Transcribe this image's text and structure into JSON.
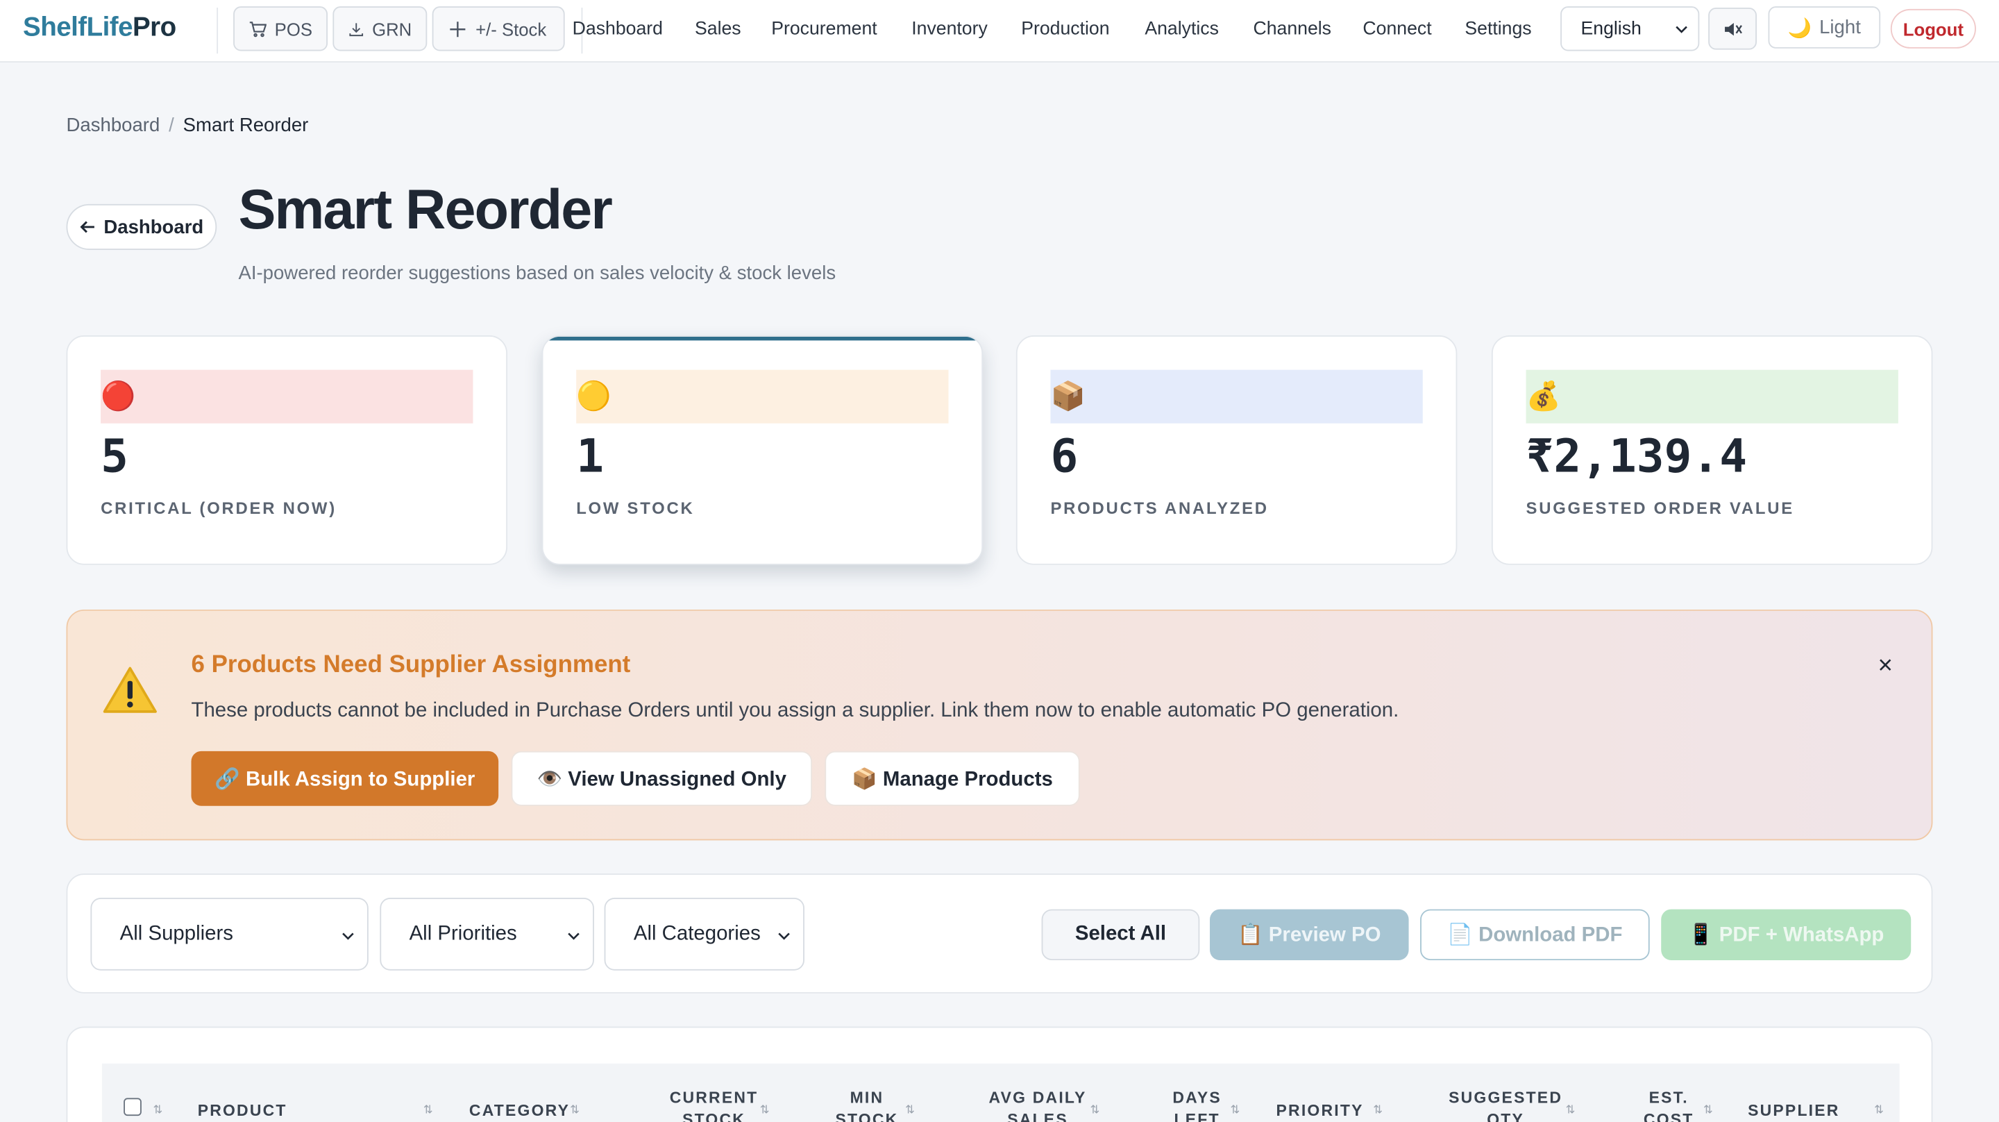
{
  "brand": {
    "part1": "ShelfLife",
    "part2": "Pro"
  },
  "quick_actions": [
    {
      "label": "POS",
      "icon": "cart-icon"
    },
    {
      "label": "GRN",
      "icon": "download-icon"
    },
    {
      "label": "+/- Stock",
      "icon": "plus-icon"
    }
  ],
  "nav": [
    "Dashboard",
    "Sales",
    "Procurement",
    "Inventory",
    "Production",
    "Analytics",
    "Channels",
    "Connect",
    "Settings"
  ],
  "language": "English",
  "theme_label": "Light",
  "logout_label": "Logout",
  "breadcrumb": {
    "root": "Dashboard",
    "sep": "/",
    "current": "Smart Reorder"
  },
  "back_label": "Dashboard",
  "page": {
    "title": "Smart Reorder",
    "subtitle": "AI-powered reorder suggestions based on sales velocity & stock levels"
  },
  "stats": [
    {
      "icon": "🔴",
      "value": "5",
      "label": "Critical (Order Now)",
      "strip": "#fbe2e2"
    },
    {
      "icon": "🟡",
      "value": "1",
      "label": "Low Stock",
      "strip": "#fdf0e1"
    },
    {
      "icon": "📦",
      "value": "6",
      "label": "Products Analyzed",
      "strip": "#e4ebfb"
    },
    {
      "icon": "💰",
      "value": "₹2,139.4",
      "label": "Suggested Order Value",
      "strip": "#e3f4e3"
    }
  ],
  "warning": {
    "title": "6 Products Need Supplier Assignment",
    "text": "These products cannot be included in Purchase Orders until you assign a supplier. Link them now to enable automatic PO generation.",
    "close": "×",
    "buttons": {
      "bulk": "🔗 Bulk Assign to Supplier",
      "view": "👁️ View Unassigned Only",
      "manage": "📦 Manage Products"
    }
  },
  "filters": {
    "supplier": "All Suppliers",
    "priority": "All Priorities",
    "category": "All Categories",
    "select_all": "Select All",
    "preview": "📋 Preview PO",
    "download": "📄 Download PDF",
    "whatsapp": "📱 PDF + WhatsApp"
  },
  "table": {
    "columns": [
      "Product",
      "Category",
      "Current Stock",
      "Min Stock",
      "Avg Daily Sales",
      "Days Left",
      "Priority",
      "Suggested Qty",
      "Est. Cost",
      "Supplier"
    ]
  },
  "colors": {
    "accent": "#2f7c9c",
    "warning": "#d2782a",
    "logout": "#c0282d"
  }
}
